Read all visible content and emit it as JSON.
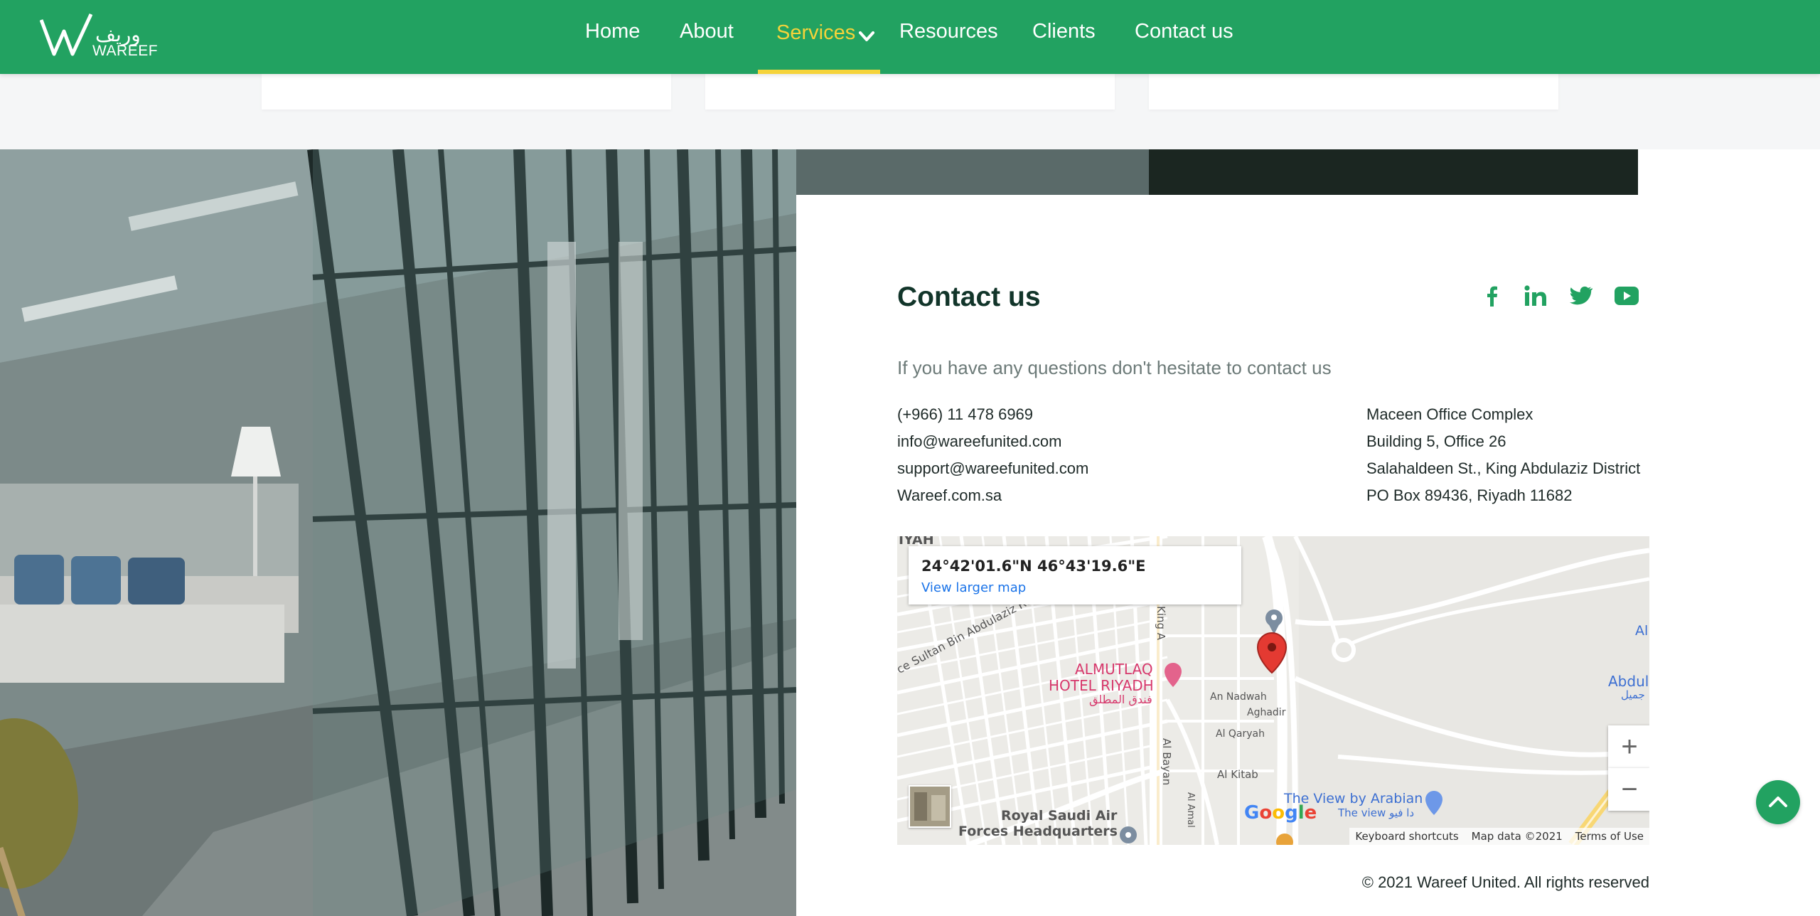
{
  "brand": {
    "name": "WAREEF",
    "name_ar": "وريف"
  },
  "nav": {
    "home": "Home",
    "about": "About",
    "services": "Services",
    "resources": "Resources",
    "clients": "Clients",
    "contact": "Contact us"
  },
  "contact": {
    "title": "Contact us",
    "intro": "If you have any questions don't hesitate to contact us",
    "phone": "(+966) 11 478 6969",
    "email": "info@wareefunited.com",
    "support": "support@wareefunited.com",
    "website": "Wareef.com.sa",
    "address": [
      "Maceen Office Complex",
      "Building 5, Office 26",
      "Salahaldeen St., King Abdulaziz District",
      "PO Box 89436, Riyadh 11682"
    ],
    "social": [
      "facebook-icon",
      "linkedin-icon",
      "twitter-icon",
      "youtube-icon"
    ]
  },
  "map": {
    "coords": "24°42'01.6\"N 46°43'19.6\"E",
    "view_larger": "View larger map",
    "labels": {
      "hotel": "ALMUTLAQ",
      "hotel2": "HOTEL RIYADH",
      "hotel_ar": "فندق المطلق",
      "air_force": "Royal Saudi Air",
      "air_force2": "Forces Headquarters",
      "view_arabian": "The View by Arabian",
      "view_ar": "The view دا فيو",
      "an_nadwah": "An Nadwah",
      "aghadir": "Aghadir",
      "al_qaryah": "Al Qaryah",
      "al_kitab": "Al Kitab",
      "al_bayan": "Al Bayan",
      "al_amal": "Al Amal",
      "sultan": "ce Sultan Bin Abdulaziz Rd",
      "abdul": "Abdul",
      "abdul_ar": "جميل",
      "al": "Al",
      "riyah": "IYAH",
      "king_ab": "King A",
      "google": "Google"
    },
    "footer": {
      "shortcuts": "Keyboard shortcuts",
      "data": "Map data ©2021",
      "terms": "Terms of Use"
    },
    "zoom_in": "+",
    "zoom_out": "−"
  },
  "copyright": "© 2021 Wareef United. All rights reserved",
  "colors": {
    "brand_green": "#22a261",
    "accent_yellow": "#f5d33a",
    "dark_text": "#12352a"
  }
}
